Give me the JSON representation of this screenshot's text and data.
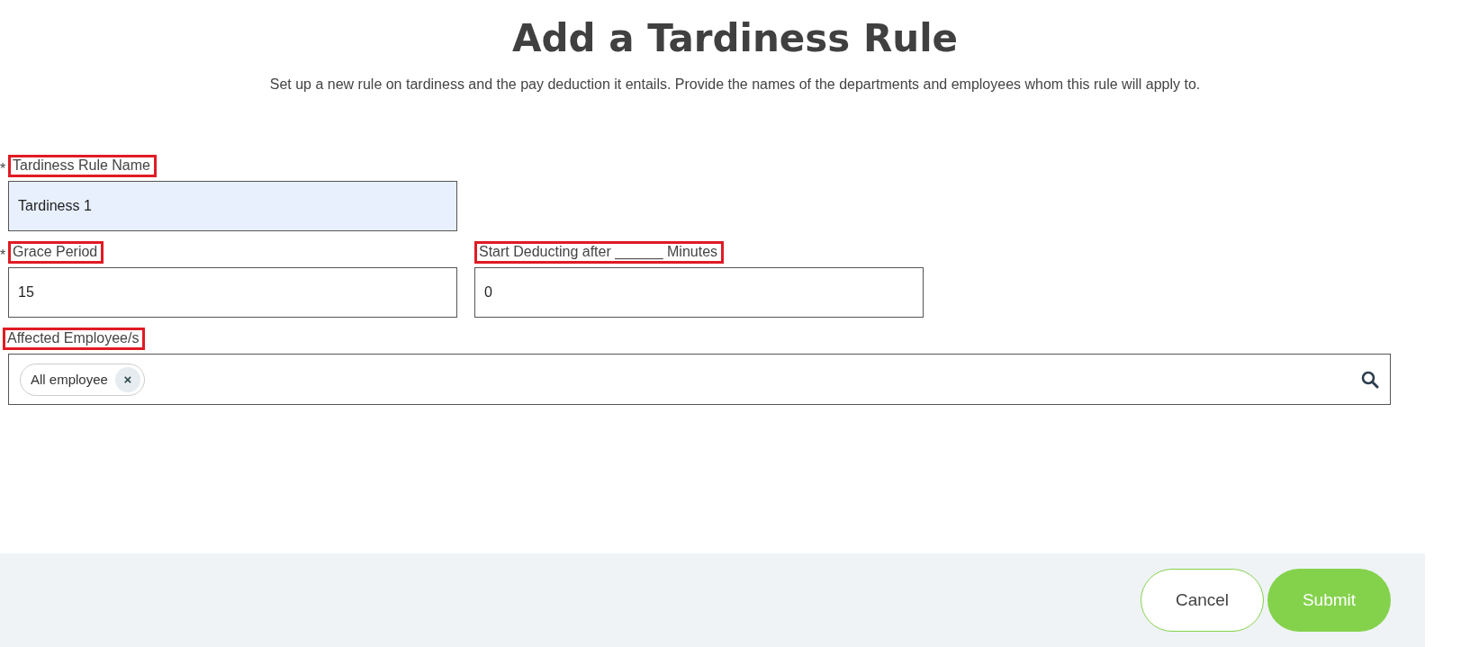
{
  "header": {
    "title": "Add a Tardiness Rule",
    "subtitle": "Set up a new rule on tardiness and the pay deduction it entails. Provide the names of the departments and employees whom this rule will apply to."
  },
  "rows": [
    {
      "fields": [
        {
          "marker": "*",
          "label": "Tardiness Rule Name",
          "highlighted": true,
          "value": "Tardiness 1",
          "filled": true
        }
      ]
    },
    {
      "fields": [
        {
          "marker": "*",
          "label": "Grace Period",
          "highlighted": true,
          "value": "15",
          "filled": false
        },
        {
          "label": "Start Deducting after ______ Minutes",
          "highlighted": true,
          "value": "0",
          "filled": false
        }
      ]
    }
  ],
  "employees": {
    "label": "Affected Employee/s",
    "highlighted": true,
    "tags": [
      {
        "text": "All employee",
        "remove": "×"
      }
    ]
  },
  "footer": {
    "buttons": [
      {
        "label": "Cancel",
        "kind": "secondary"
      },
      {
        "label": "Submit",
        "kind": "primary"
      }
    ]
  }
}
